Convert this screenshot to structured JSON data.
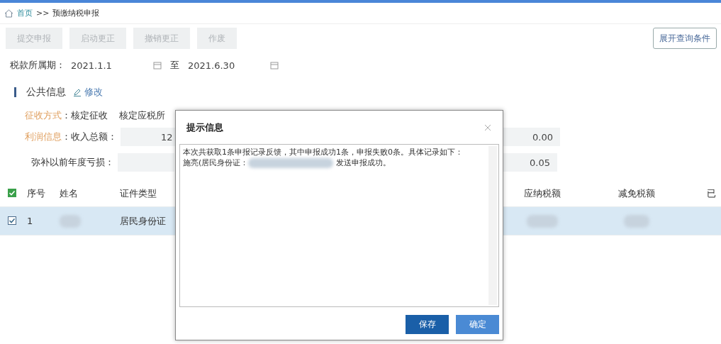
{
  "breadcrumb": {
    "home": "首页",
    "separator": ">>",
    "current": "预缴纳税申报"
  },
  "toolbar": {
    "buttons": [
      {
        "label": "提交申报",
        "disabled": true
      },
      {
        "label": "启动更正",
        "disabled": true
      },
      {
        "label": "撤销更正",
        "disabled": true
      },
      {
        "label": "作废",
        "disabled": true
      }
    ],
    "expand_button": "展开查询条件"
  },
  "period": {
    "label": "税款所属期：",
    "start": "2021.1.1",
    "to": "至",
    "end": "2021.6.30"
  },
  "public_info": {
    "title": "公共信息",
    "edit": "修改",
    "collection_label": "征收方式",
    "collection_value": "：核定征收",
    "assessed_label": "核定应税所",
    "profit_label": "利润信息",
    "income_label": "：收入总额：",
    "income_value": "12",
    "right_value_1": "0.00",
    "loss_label": "弥补以前年度亏损：",
    "right_value_2": "0.05"
  },
  "table": {
    "all_checked": true,
    "columns": [
      "序号",
      "姓名",
      "证件类型",
      "应纳税额",
      "减免税额",
      "已"
    ],
    "rows": [
      {
        "checked": true,
        "selected": true,
        "index": "1",
        "id_type": "居民身份证"
      }
    ]
  },
  "dialog": {
    "title": "提示信息",
    "line_1": "本次共获取1条申报记录反馈，其中申报成功1条，申报失败0条。具体记录如下：",
    "line_2_start": "施亮(居民身份证：",
    "line_2_end": "发送申报成功。",
    "buttons": [
      {
        "label": "保存",
        "kind": "primary"
      },
      {
        "label": "确定",
        "kind": "secondary"
      }
    ]
  }
}
